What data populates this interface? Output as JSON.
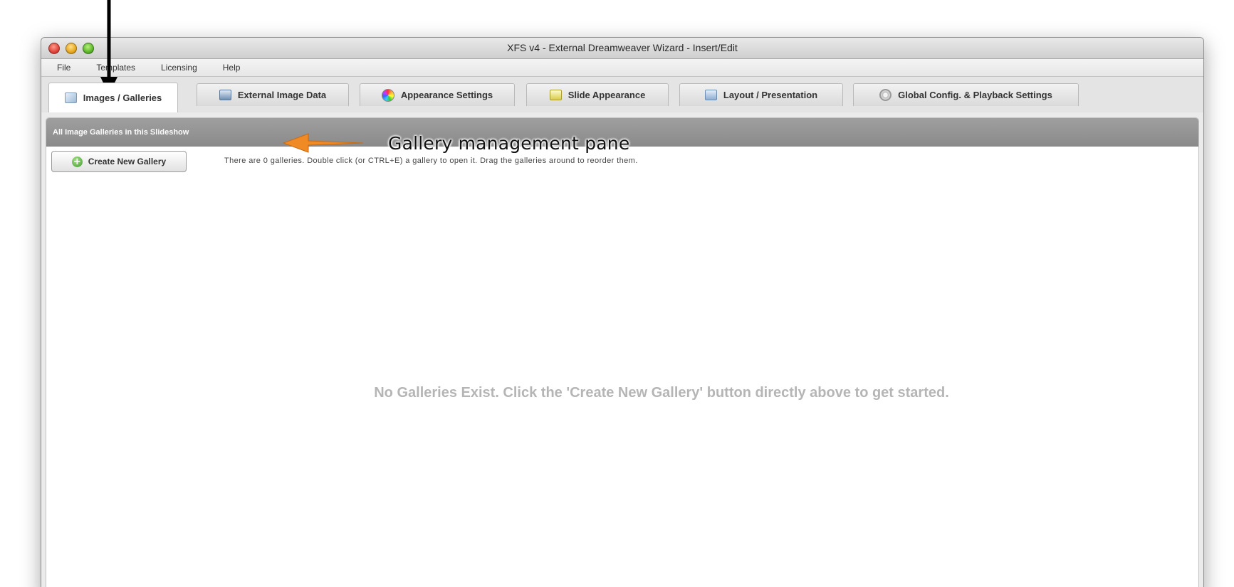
{
  "window": {
    "title": "XFS v4 - External Dreamweaver Wizard - Insert/Edit"
  },
  "menu": {
    "items": [
      "File",
      "Templates",
      "Licensing",
      "Help"
    ]
  },
  "tabs": [
    {
      "label": "Images / Galleries",
      "icon": "images-icon",
      "active": true
    },
    {
      "label": "External Image Data",
      "icon": "external-data-icon",
      "active": false
    },
    {
      "label": "Appearance Settings",
      "icon": "color-wheel-icon",
      "active": false
    },
    {
      "label": "Slide Appearance",
      "icon": "slide-icon",
      "active": false
    },
    {
      "label": "Layout / Presentation",
      "icon": "layout-icon",
      "active": false
    },
    {
      "label": "Global Config. & Playback Settings",
      "icon": "gear-icon",
      "active": false
    }
  ],
  "pane": {
    "header_title": "All Image Galleries in this Slideshow",
    "create_button_label": "Create New Gallery",
    "info_text": "There are 0 galleries.  Double click (or CTRL+E) a gallery to open it.  Drag the galleries around to reorder them.",
    "empty_message": "No Galleries Exist.  Click the 'Create New Gallery' button directly above to get started."
  },
  "annotations": {
    "label": "Gallery management pane",
    "arrow_color": "#f08a24"
  }
}
